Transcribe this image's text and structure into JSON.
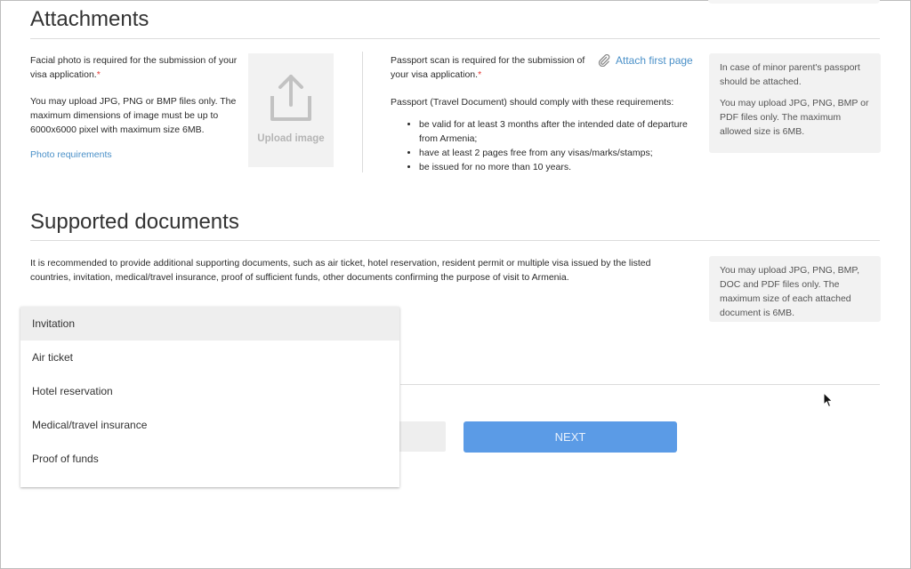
{
  "attachments": {
    "heading": "Attachments",
    "facial_photo": {
      "required_text": "Facial photo is required for the submission of your visa application.",
      "required_mark": "*",
      "formats_text": "You may upload JPG, PNG or BMP files only. The maximum dimensions of image must be up to 6000x6000 pixel with maximum size 6MB.",
      "requirements_link": "Photo requirements",
      "upload_label": "Upload image",
      "upload_icon": "upload-icon"
    },
    "passport": {
      "required_text": "Passport scan is required for the submission of your visa application.",
      "required_mark": "*",
      "attach_link": "Attach first page",
      "attach_icon": "paperclip-icon",
      "comply_text": "Passport (Travel Document) should comply with these requirements:",
      "requirements": [
        "be valid for at least 3 months after the intended date of departure from Armenia;",
        "have at least 2 pages free from any visas/marks/stamps;",
        "be issued for no more than 10 years."
      ]
    },
    "info_card": {
      "minor_text": "In case of minor parent's passport should be attached.",
      "formats_text": "You may upload JPG, PNG, BMP or PDF files only. The maximum allowed size is 6MB."
    }
  },
  "supported": {
    "heading": "Supported documents",
    "description": "It is recommended to provide additional supporting documents, such as air ticket, hotel reservation, resident permit or multiple visa issued by the listed countries, invitation, medical/travel insurance, proof of sufficient funds, other documents confirming the purpose of visit to Armenia.",
    "info_card": {
      "formats_text": "You may upload JPG, PNG, BMP, DOC and PDF files only. The maximum size of each attached document is 6MB."
    },
    "dropdown": {
      "selected_index": 0,
      "options": [
        "Invitation",
        "Air ticket",
        "Hotel reservation",
        "Medical/travel insurance",
        "Proof of funds"
      ]
    }
  },
  "nav": {
    "next_label": "NEXT"
  },
  "colors": {
    "accent": "#5b9be6",
    "link": "#4a90c8",
    "required": "#e53935",
    "card_bg": "#f2f2f2"
  }
}
